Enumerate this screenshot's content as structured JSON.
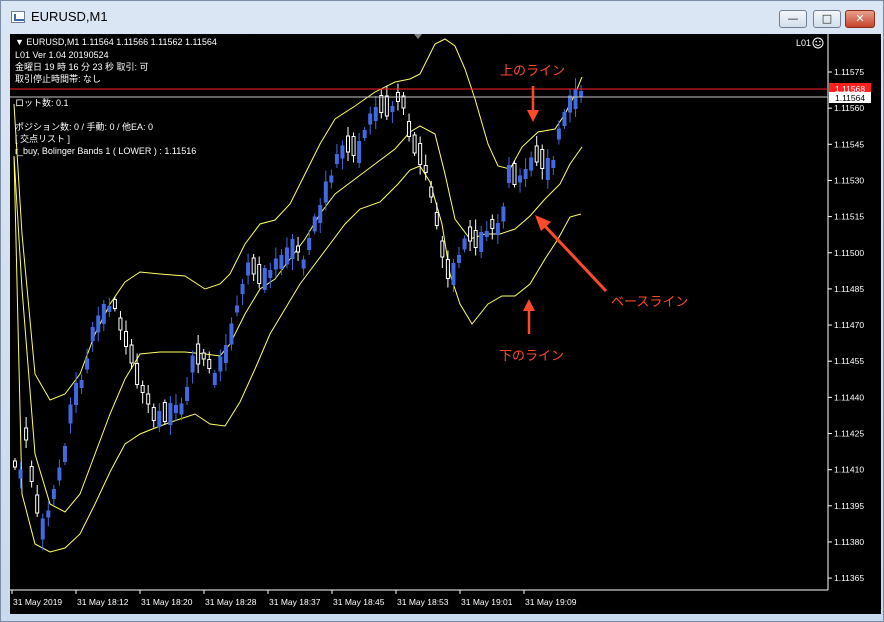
{
  "window": {
    "title": "EURUSD,M1",
    "btn_min": "—",
    "btn_max": "□",
    "btn_close": "✕"
  },
  "info": {
    "symbol_line": "▼ EURUSD,M1  1.11564 1.11566 1.11562 1.11564",
    "version_line": "L01 Ver 1.04 20190524",
    "time_line": "金曜日 19 時 16 分 23 秒 取引: 可",
    "stop_line": "取引停止時間帯: なし",
    "lot_line": "ロット数: 0.1",
    "position_line": "ポジション数: 0 / 手動: 0 / 他EA: 0",
    "list_line": "[ 交点リスト ]",
    "buy_line": "r_buy, Bolinger Bands 1 ( LOWER ) : 1.11516"
  },
  "ea_label": "L01",
  "smiley_icon": "smiley-face-icon",
  "price_labels": [
    "1.11575",
    "1.11560",
    "1.11545",
    "1.11530",
    "1.11515",
    "1.11500",
    "1.11485",
    "1.11470",
    "1.11455",
    "1.11440",
    "1.11425",
    "1.11410",
    "1.11395",
    "1.11380",
    "1.11365"
  ],
  "red_line_tag": "1.11568",
  "bid_tag": "1.11564",
  "time_labels": [
    "31 May 2019",
    "31 May 18:12",
    "31 May 18:20",
    "31 May 18:28",
    "31 May 18:37",
    "31 May 18:45",
    "31 May 18:53",
    "31 May 19:01",
    "31 May 19:09"
  ],
  "annotations": {
    "upper": "上のライン",
    "base": "ベースライン",
    "lower": "下のライン"
  },
  "colors": {
    "bull": "#4169e1",
    "bear": "#ffffff",
    "band": "#ffff66",
    "red_line": "#ff2020",
    "annotation": "#ff4a2a"
  }
}
